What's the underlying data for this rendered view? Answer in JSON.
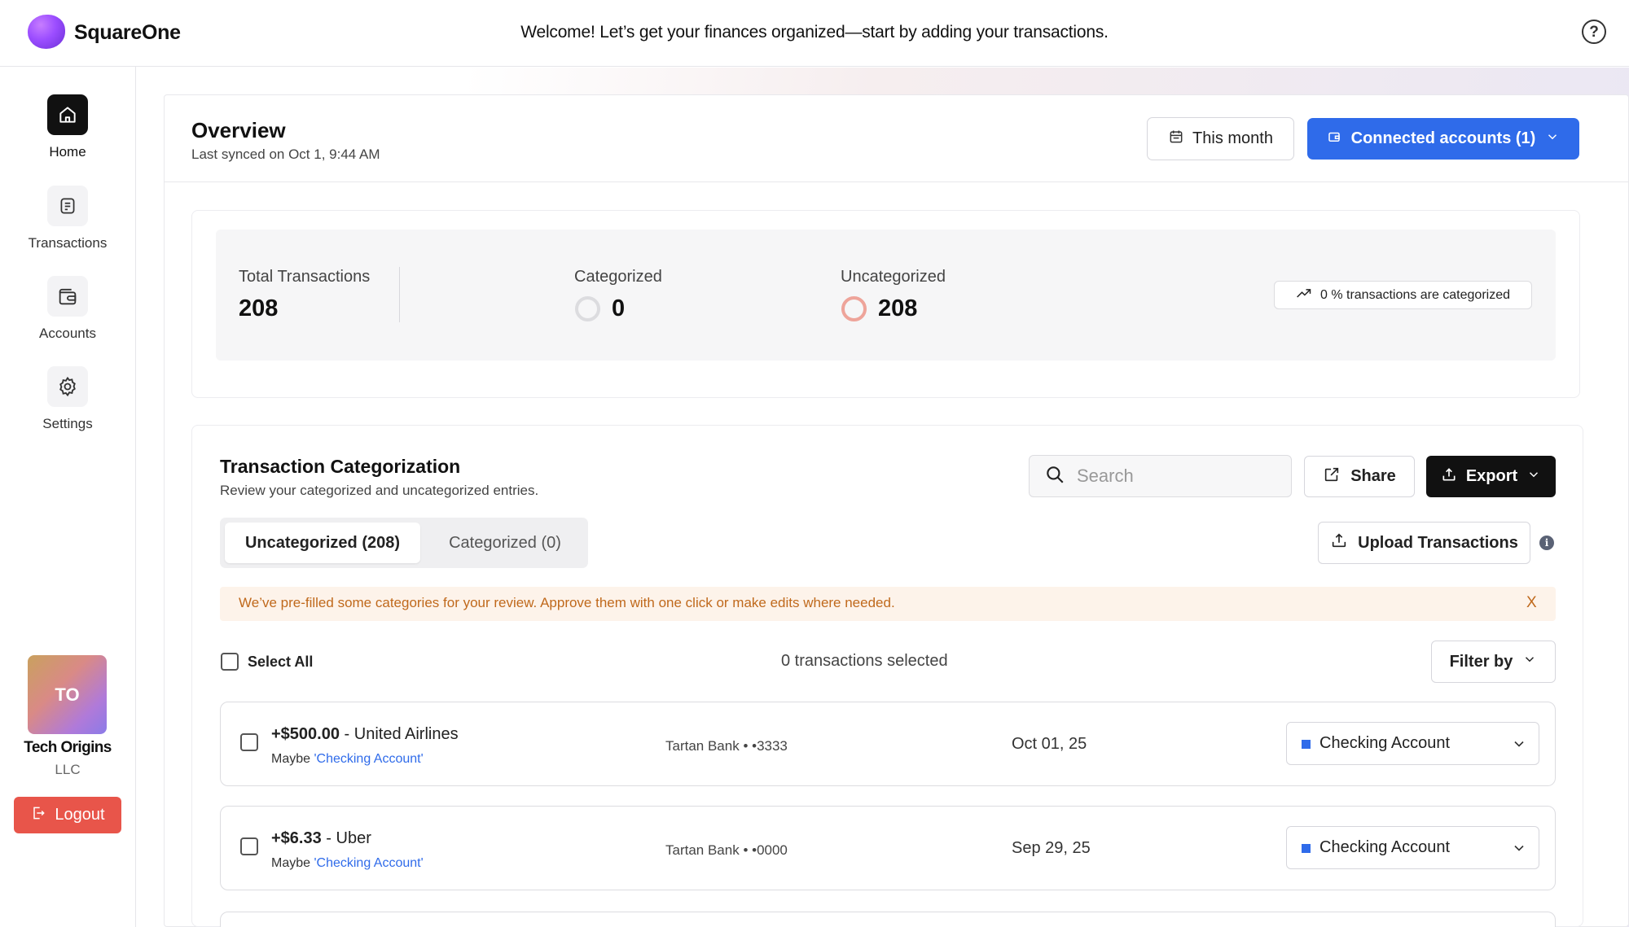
{
  "app": {
    "brand": "SquareOne",
    "welcome": "Welcome! Let’s get your finances organized—start by adding your transactions."
  },
  "sidebar": {
    "items": [
      {
        "label": "Home",
        "icon": "home-icon",
        "active": true
      },
      {
        "label": "Transactions",
        "icon": "document-icon",
        "active": false
      },
      {
        "label": "Accounts",
        "icon": "wallet-icon",
        "active": false
      },
      {
        "label": "Settings",
        "icon": "gear-icon",
        "active": false
      }
    ],
    "org": {
      "initials": "TO",
      "name": "Tech Origins",
      "suffix": "LLC"
    },
    "logout_label": "Logout"
  },
  "overview": {
    "title": "Overview",
    "subtitle": "Last synced on Oct 1, 9:44 AM",
    "date_filter_label": "This month",
    "accounts_button_label": "Connected accounts (1)"
  },
  "stats": {
    "total_label": "Total Transactions",
    "total_value": "208",
    "categorized_label": "Categorized",
    "categorized_value": "0",
    "uncategorized_label": "Uncategorized",
    "uncategorized_value": "208",
    "percent_text": "0 % transactions are categorized"
  },
  "categorization": {
    "title": "Transaction Categorization",
    "subtitle": "Review your categorized and uncategorized entries.",
    "search_placeholder": "Search",
    "share_label": "Share",
    "export_label": "Export",
    "tabs": [
      {
        "label": "Uncategorized (208)",
        "active": true
      },
      {
        "label": "Categorized (0)",
        "active": false
      }
    ],
    "upload_label": "Upload Transactions",
    "banner_text": "We’ve pre-filled some categories for your review. Approve them with one click or make edits where needed.",
    "banner_close": "X",
    "select_all_label": "Select All",
    "selected_count_text": "0 transactions selected",
    "filter_label": "Filter by"
  },
  "transactions": [
    {
      "amount": "+$500.00",
      "merchant": " - United Airlines",
      "maybe_prefix": "Maybe ",
      "maybe_account": "'Checking Account'",
      "bank": "Tartan Bank • •3333",
      "date": "Oct 01, 25",
      "category": "Checking Account"
    },
    {
      "amount": "+$6.33",
      "merchant": " - Uber",
      "maybe_prefix": "Maybe ",
      "maybe_account": "'Checking Account'",
      "bank": "Tartan Bank • •0000",
      "date": "Sep 29, 25",
      "category": "Checking Account"
    }
  ],
  "colors": {
    "accent": "#2f6bea",
    "dark": "#111111",
    "logout": "#e8554a",
    "banner_text": "#c0691c",
    "banner_bg": "#fdf3ea"
  }
}
